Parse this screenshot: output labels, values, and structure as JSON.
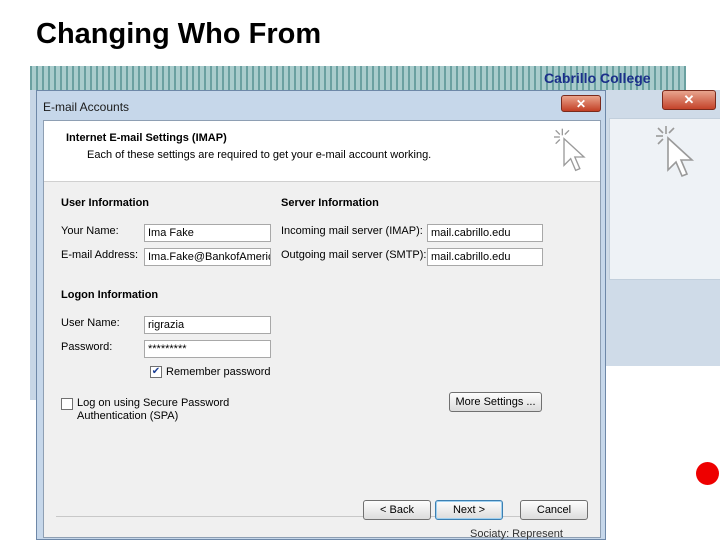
{
  "slide": {
    "title": "Changing Who From"
  },
  "banner": {
    "label": "Cabrillo College"
  },
  "background_window": {
    "close_label": "✕"
  },
  "dialog": {
    "window_title": "E-mail Accounts",
    "close_label": "✕",
    "header_title": "Internet E-mail Settings (IMAP)",
    "header_subtitle": "Each of these settings are required to get your e-mail account working.",
    "user_info": {
      "section_label": "User Information",
      "name_label": "Your Name:",
      "name_value": "Ima Fake",
      "email_label": "E-mail Address:",
      "email_value": "Ima.Fake@BankofAmerica"
    },
    "server_info": {
      "section_label": "Server Information",
      "incoming_label": "Incoming mail server (IMAP):",
      "incoming_value": "mail.cabrillo.edu",
      "outgoing_label": "Outgoing mail server (SMTP):",
      "outgoing_value": "mail.cabrillo.edu"
    },
    "logon_info": {
      "section_label": "Logon Information",
      "username_label": "User Name:",
      "username_value": "rigrazia",
      "password_label": "Password:",
      "password_value": "*********",
      "remember_label": "Remember password",
      "remember_checked": true,
      "spa_label_line1": "Log on using Secure Password",
      "spa_label_line2": "Authentication (SPA)",
      "spa_checked": false
    },
    "more_settings_label": "More Settings ...",
    "buttons": {
      "back": "< Back",
      "next": "Next >",
      "cancel": "Cancel"
    }
  },
  "bottom_text": "Sociaty: Represent",
  "colors": {
    "dialog_frame": "#c6d7ea",
    "close_button": "#c23f25",
    "banner_text": "#1b2f8a",
    "red_dot": "#ee0000"
  }
}
